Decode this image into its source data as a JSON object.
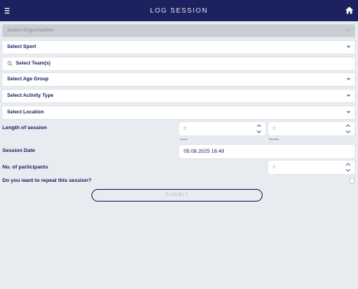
{
  "header": {
    "title": "LOG SESSION",
    "menu_icon": "hamburger-menu-icon",
    "home_icon": "home-icon",
    "background": "#1c2160"
  },
  "form": {
    "organisation": {
      "placeholder": "Select Organisation",
      "disabled": true
    },
    "sport": {
      "placeholder": "Select Sport"
    },
    "teams": {
      "placeholder": "Select Team(s)",
      "icon": "search-icon"
    },
    "age_group": {
      "placeholder": "Select Age Group"
    },
    "activity_type": {
      "placeholder": "Select Activity Type"
    },
    "location": {
      "placeholder": "Select Location"
    },
    "length": {
      "label": "Length of session",
      "hours_value": "0",
      "hours_sub": "Hours",
      "minutes_value": "0",
      "minutes_sub": "Minutes"
    },
    "date": {
      "label": "Session Date",
      "value": "05.08.2025 16:49"
    },
    "participants": {
      "label": "No. of participants",
      "value": "0"
    },
    "repeat": {
      "label": "Do you want to repeat this session?",
      "checked": false
    },
    "submit_label": "SUBMIT"
  },
  "colors": {
    "primary": "#1c2160",
    "page_background": "#e8ebf0",
    "disabled_field": "#c9ccd1"
  }
}
